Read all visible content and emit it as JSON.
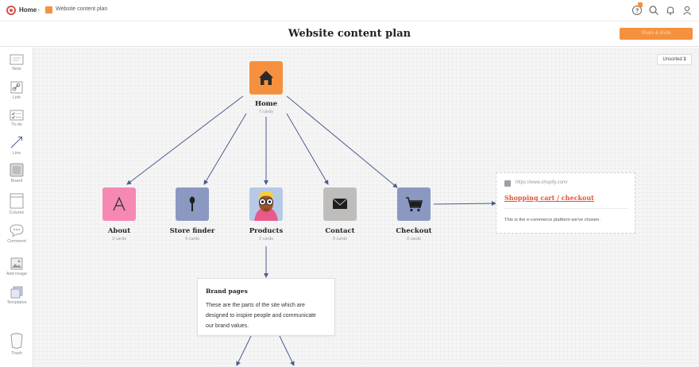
{
  "breadcrumb": {
    "home": "Home",
    "separator": "›",
    "board": "Website content plan"
  },
  "header": {
    "title": "Website content plan",
    "share_button": "Share & invite"
  },
  "topbar_icons": [
    "help-badge-icon",
    "search-icon",
    "bell-icon",
    "user-icon"
  ],
  "toolbar": {
    "items": [
      {
        "label": "Note",
        "icon": "note-icon"
      },
      {
        "label": "Link",
        "icon": "link-icon"
      },
      {
        "label": "To-do",
        "icon": "todo-icon"
      },
      {
        "label": "Line",
        "icon": "line-icon"
      },
      {
        "label": "Board",
        "icon": "board-icon"
      },
      {
        "label": "Column",
        "icon": "column-icon"
      },
      {
        "label": "Comment",
        "icon": "comment-icon"
      },
      {
        "label": "Add image",
        "icon": "image-icon"
      },
      {
        "label": "Templates",
        "icon": "templates-icon"
      }
    ],
    "trash": {
      "label": "Trash",
      "icon": "trash-icon"
    }
  },
  "unsorted": {
    "label": "Unsorted",
    "count": "1"
  },
  "nodes": {
    "home": {
      "title": "Home",
      "count": "7 cards",
      "icon": "house-icon",
      "color": "#f5913e"
    },
    "about": {
      "title": "About",
      "count": "3 cards",
      "icon": "letter-a-icon",
      "color": "#f589b3"
    },
    "store": {
      "title": "Store finder",
      "count": "4 cards",
      "icon": "pin-icon",
      "color": "#8a98c2"
    },
    "products": {
      "title": "Products",
      "count": "2 cards",
      "icon": "product-image-icon",
      "color": "#b7c9e8"
    },
    "contact": {
      "title": "Contact",
      "count": "0 cards",
      "icon": "envelope-icon",
      "color": "#bfbdbb"
    },
    "checkout": {
      "title": "Checkout",
      "count": "0 cards",
      "icon": "cart-icon",
      "color": "#8a98c2"
    }
  },
  "brand_card": {
    "title": "Brand pages",
    "description": "These are the parts of the site which are designed to inspire people and communicate our brand values."
  },
  "link_card": {
    "url": "https://www.shopify.com/",
    "title": "Shopping cart / checkout",
    "description": "This is the e-commerce platform we've chosen."
  },
  "colors": {
    "accent": "#f5913e",
    "connector": "#4a5d8f",
    "link": "#e0533b"
  }
}
